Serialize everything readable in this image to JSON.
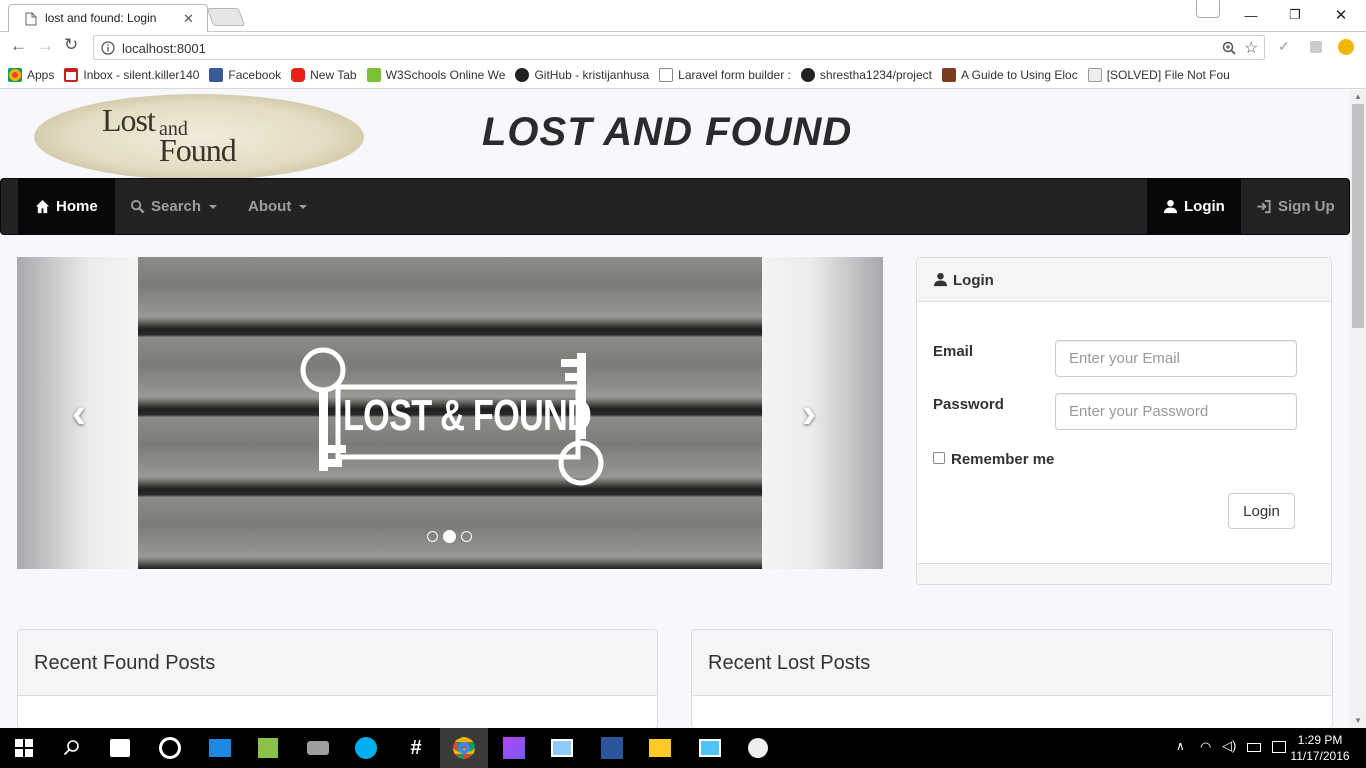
{
  "browser": {
    "tab_title": "lost and found: Login",
    "url": "localhost:8001",
    "bookmarks": [
      {
        "label": "Apps",
        "icon": "apps-grid-icon",
        "color": "#e8453c"
      },
      {
        "label": "Inbox - silent.killer140",
        "icon": "gmail-icon",
        "color": "#c5221f"
      },
      {
        "label": "Facebook",
        "icon": "facebook-icon",
        "color": "#3b5998"
      },
      {
        "label": "New Tab",
        "icon": "youtube-icon",
        "color": "#e62117"
      },
      {
        "label": "W3Schools Online We",
        "icon": "w3schools-icon",
        "color": "#7bbf35"
      },
      {
        "label": "GitHub - kristijanhusa",
        "icon": "github-icon",
        "color": "#222222"
      },
      {
        "label": "Laravel form builder :",
        "icon": "page-icon",
        "color": "#888888"
      },
      {
        "label": "shrestha1234/project",
        "icon": "github-icon",
        "color": "#222222"
      },
      {
        "label": "A Guide to Using Eloc",
        "icon": "site-icon",
        "color": "#7a3b1e"
      },
      {
        "label": "[SOLVED] File Not Fou",
        "icon": "site-icon",
        "color": "#999999"
      }
    ]
  },
  "header": {
    "logo": {
      "line1": "Lost",
      "line2": "and",
      "line3": "Found"
    },
    "title": "LOST AND FOUND"
  },
  "nav": {
    "home": "Home",
    "search": "Search",
    "about": "About",
    "login": "Login",
    "signup": "Sign Up"
  },
  "carousel": {
    "image_text": "LOST & FOUND",
    "active_indicator": 2,
    "indicator_count": 3
  },
  "login_panel": {
    "heading": "Login",
    "email_label": "Email",
    "email_placeholder": "Enter your Email",
    "password_label": "Password",
    "password_placeholder": "Enter your Password",
    "remember_label": "Remember me",
    "submit_label": "Login"
  },
  "recent": {
    "found_title": "Recent Found Posts",
    "lost_title": "Recent Lost Posts"
  },
  "taskbar": {
    "time": "1:29 PM",
    "date": "11/17/2016"
  },
  "colors": {
    "navbar": "#222222",
    "navbar_active": "#080808",
    "page_bg": "#f7f8fc"
  }
}
